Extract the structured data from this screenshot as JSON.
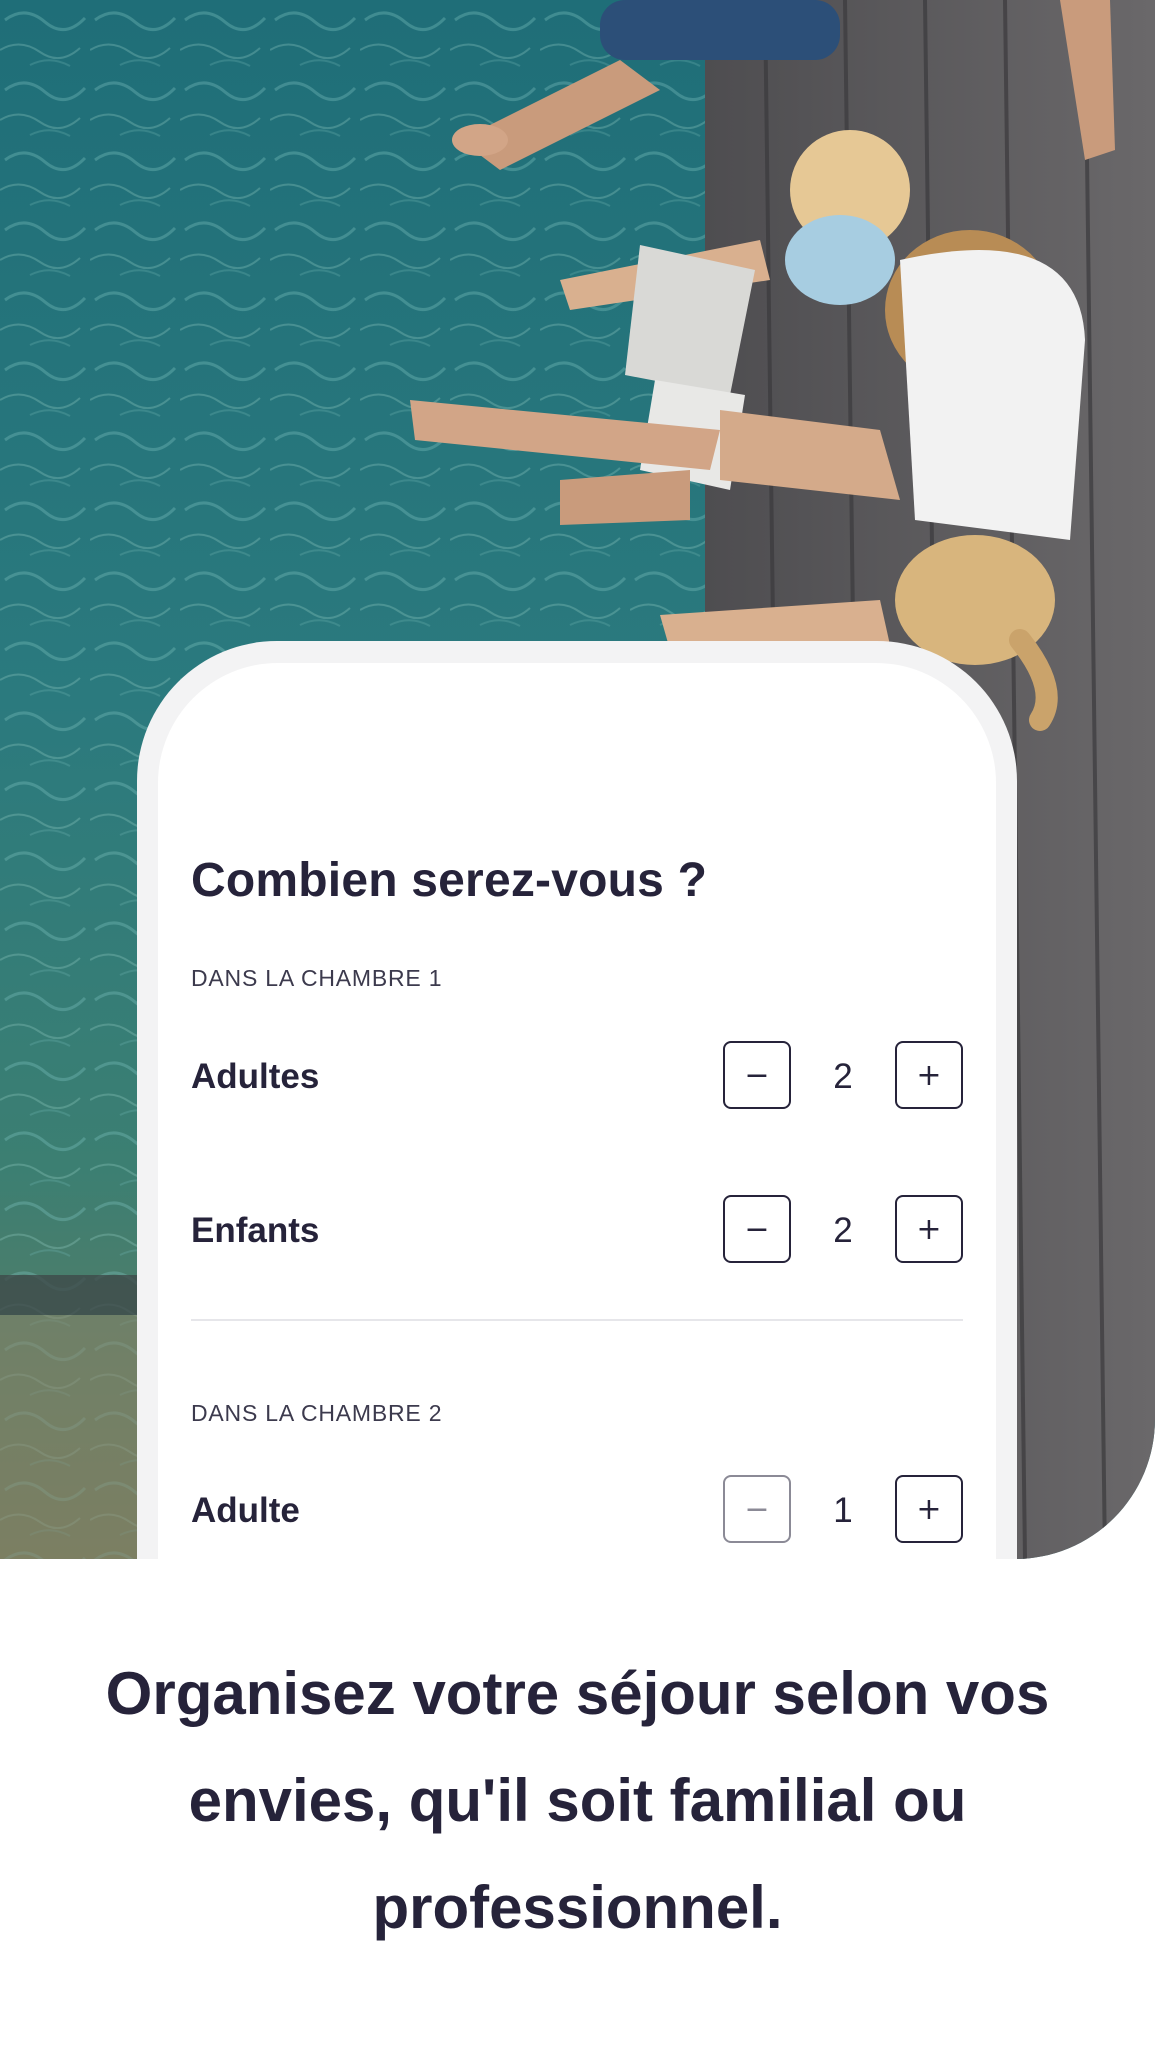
{
  "card": {
    "title": "Combien serez-vous ?",
    "rooms": [
      {
        "label": "DANS LA CHAMBRE 1",
        "rows": [
          {
            "label": "Adultes",
            "value": "2",
            "minus_icon": "−",
            "plus_icon": "+"
          },
          {
            "label": "Enfants",
            "value": "2",
            "minus_icon": "−",
            "plus_icon": "+"
          }
        ]
      },
      {
        "label": "DANS LA CHAMBRE 2",
        "rows": [
          {
            "label": "Adulte",
            "value": "1",
            "minus_icon": "−",
            "plus_icon": "+",
            "minus_disabled": true
          }
        ]
      }
    ]
  },
  "tagline": "Organisez votre séjour selon vos envies, qu'il soit familial ou professionnel.",
  "colors": {
    "text": "#26233a",
    "water": "#2d6f74",
    "deck": "#5a5a5c",
    "card_frame": "#f3f3f4"
  },
  "hero": {
    "image_description_icon": "family-by-pool-photo"
  }
}
